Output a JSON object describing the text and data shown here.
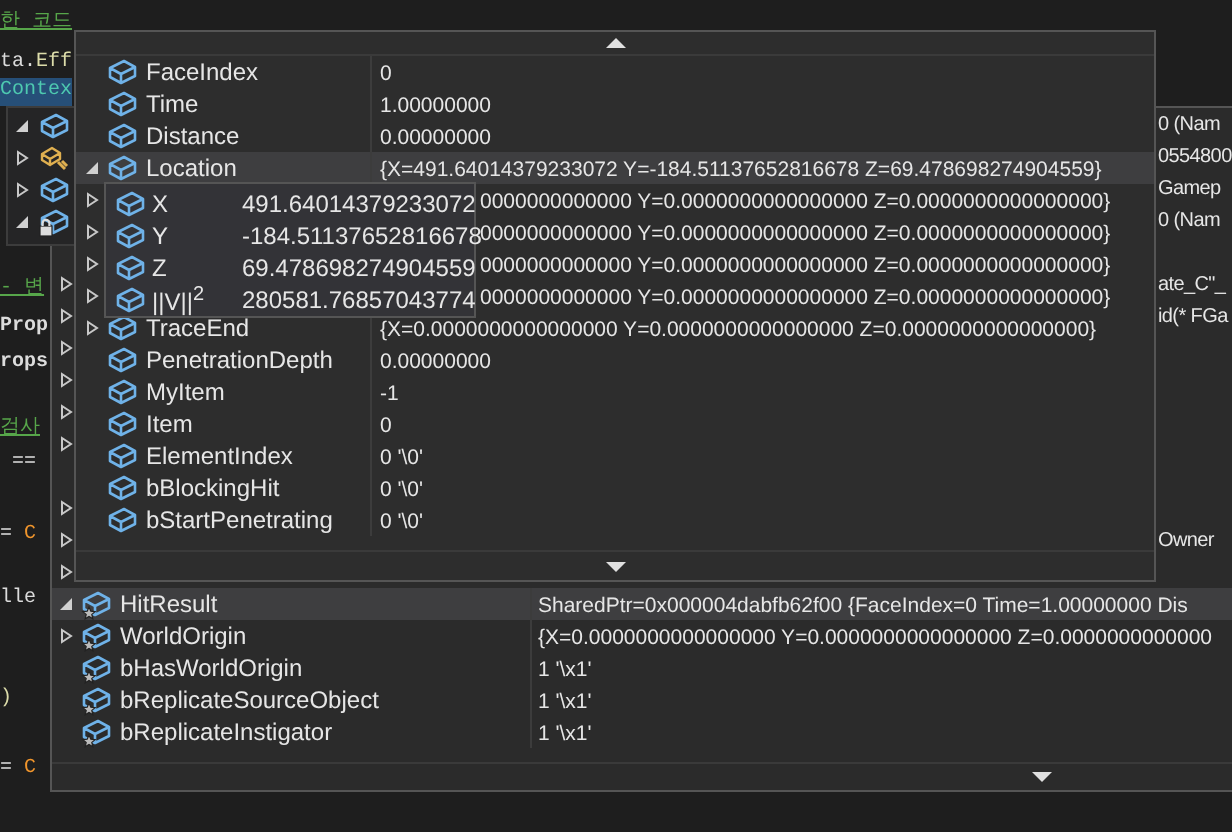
{
  "editor": {
    "code_lines": [
      {
        "segments": [
          {
            "text": "한 코드",
            "kind": "comment"
          }
        ]
      },
      {
        "segments": [
          {
            "text": "ta.",
            "kind": "plain"
          },
          {
            "text": "Eff",
            "kind": "method"
          }
        ]
      },
      {
        "segments": [
          {
            "text": "Contex",
            "kind": "type"
          }
        ],
        "selected": true
      },
      {
        "segments": [
          {
            "text": "- 변",
            "kind": "comment"
          }
        ]
      },
      {
        "segments": [
          {
            "text": "Prop",
            "kind": "plain"
          }
        ]
      },
      {
        "segments": [
          {
            "text": "rops",
            "kind": "plain"
          }
        ]
      },
      {
        "segments": [
          {
            "text": "검사",
            "kind": "comment"
          }
        ]
      },
      {
        "segments": [
          {
            "text": " ==",
            "kind": "plain"
          }
        ]
      },
      {
        "segments": [
          {
            "text": "= ",
            "kind": "plain"
          },
          {
            "text": "C",
            "kind": "keyword"
          }
        ]
      },
      {
        "segments": [
          {
            "text": "lle",
            "kind": "plain"
          }
        ]
      },
      {
        "segments": [
          {
            "text": ")",
            "kind": "method"
          }
        ]
      },
      {
        "segments": [
          {
            "text": "= ",
            "kind": "plain"
          },
          {
            "text": "C",
            "kind": "keyword"
          }
        ]
      }
    ]
  },
  "parent_tip": {
    "rows": [
      {
        "expanded": true,
        "kind": "field"
      },
      {
        "expanded": false,
        "kind": "method"
      },
      {
        "expanded": false,
        "kind": "field"
      },
      {
        "expanded": true,
        "kind": "private"
      }
    ]
  },
  "outer_tip": {
    "covered_rows": [
      {
        "value": "0 (Nam"
      },
      {
        "value": "0554800"
      },
      {
        "value": "Gamep"
      },
      {
        "value": "0 (Nam"
      },
      {},
      {
        "expanded": false,
        "value": "ate_C\"_"
      },
      {
        "expanded": false,
        "value": "id(* FGa"
      },
      {
        "expanded": false
      },
      {
        "expanded": false
      },
      {
        "expanded": false
      },
      {
        "expanded": false
      },
      {},
      {
        "expanded": false
      },
      {
        "expanded": false,
        "value": "Owner"
      },
      {
        "expanded": false
      }
    ],
    "rows": [
      {
        "name": "HitResult",
        "value": "SharedPtr=0x000004dabfb62f00 {FaceIndex=0 Time=1.00000000 Dis",
        "expanded": true,
        "selected": true
      },
      {
        "name": "WorldOrigin",
        "value": "{X=0.0000000000000000 Y=0.0000000000000000 Z=0.0000000000000",
        "expanded": false,
        "selected": false
      },
      {
        "name": "bHasWorldOrigin",
        "value": "1 '\\x1'",
        "selected": false
      },
      {
        "name": "bReplicateSourceObject",
        "value": "1 '\\x1'",
        "selected": false
      },
      {
        "name": "bReplicateInstigator",
        "value": "1 '\\x1'",
        "selected": false
      }
    ]
  },
  "middle_tip": {
    "rows": [
      {
        "kind": "normal",
        "name": "FaceIndex",
        "value": "0",
        "selected": false
      },
      {
        "kind": "normal",
        "name": "Time",
        "value": "1.00000000",
        "selected": false
      },
      {
        "kind": "normal",
        "name": "Distance",
        "value": "0.00000000",
        "selected": false
      },
      {
        "kind": "normal",
        "name": "Location",
        "value": "{X=491.64014379233072 Y=-184.51137652816678 Z=69.478698274904559}",
        "expanded": true,
        "selected": true
      },
      {
        "kind": "covered",
        "value": "0000000000000 Y=0.0000000000000000 Z=0.0000000000000000}",
        "expanded": false,
        "selected": false
      },
      {
        "kind": "covered",
        "value": "0000000000000 Y=0.0000000000000000 Z=0.0000000000000000}",
        "expanded": false,
        "selected": false
      },
      {
        "kind": "covered",
        "value": "0000000000000 Y=0.0000000000000000 Z=0.0000000000000000}",
        "expanded": false,
        "selected": false
      },
      {
        "kind": "covered",
        "value": "0000000000000 Y=0.0000000000000000 Z=0.0000000000000000}",
        "expanded": false,
        "selected": false
      },
      {
        "kind": "normal",
        "name": "TraceEnd",
        "value": "{X=0.0000000000000000 Y=0.0000000000000000 Z=0.0000000000000000}",
        "expanded": false,
        "selected": false
      },
      {
        "kind": "normal",
        "name": "PenetrationDepth",
        "value": "0.00000000",
        "selected": false
      },
      {
        "kind": "normal",
        "name": "MyItem",
        "value": "-1",
        "selected": false
      },
      {
        "kind": "normal",
        "name": "Item",
        "value": "0",
        "selected": false
      },
      {
        "kind": "normal",
        "name": "ElementIndex",
        "value": "0 '\\0'",
        "selected": false
      },
      {
        "kind": "normal",
        "name": "bBlockingHit",
        "value": "0 '\\0'",
        "selected": false
      },
      {
        "kind": "normal",
        "name": "bStartPenetrating",
        "value": "0 '\\0'",
        "selected": false
      }
    ]
  },
  "inner_tip": {
    "rows": [
      {
        "name": "X",
        "value": "491.64014379233072"
      },
      {
        "name": "Y",
        "value": "-184.51137652816678"
      },
      {
        "name": "Z",
        "value": "69.478698274904559"
      },
      {
        "name": "||V||$^{2}$",
        "value": "280581.76857043774"
      }
    ]
  }
}
